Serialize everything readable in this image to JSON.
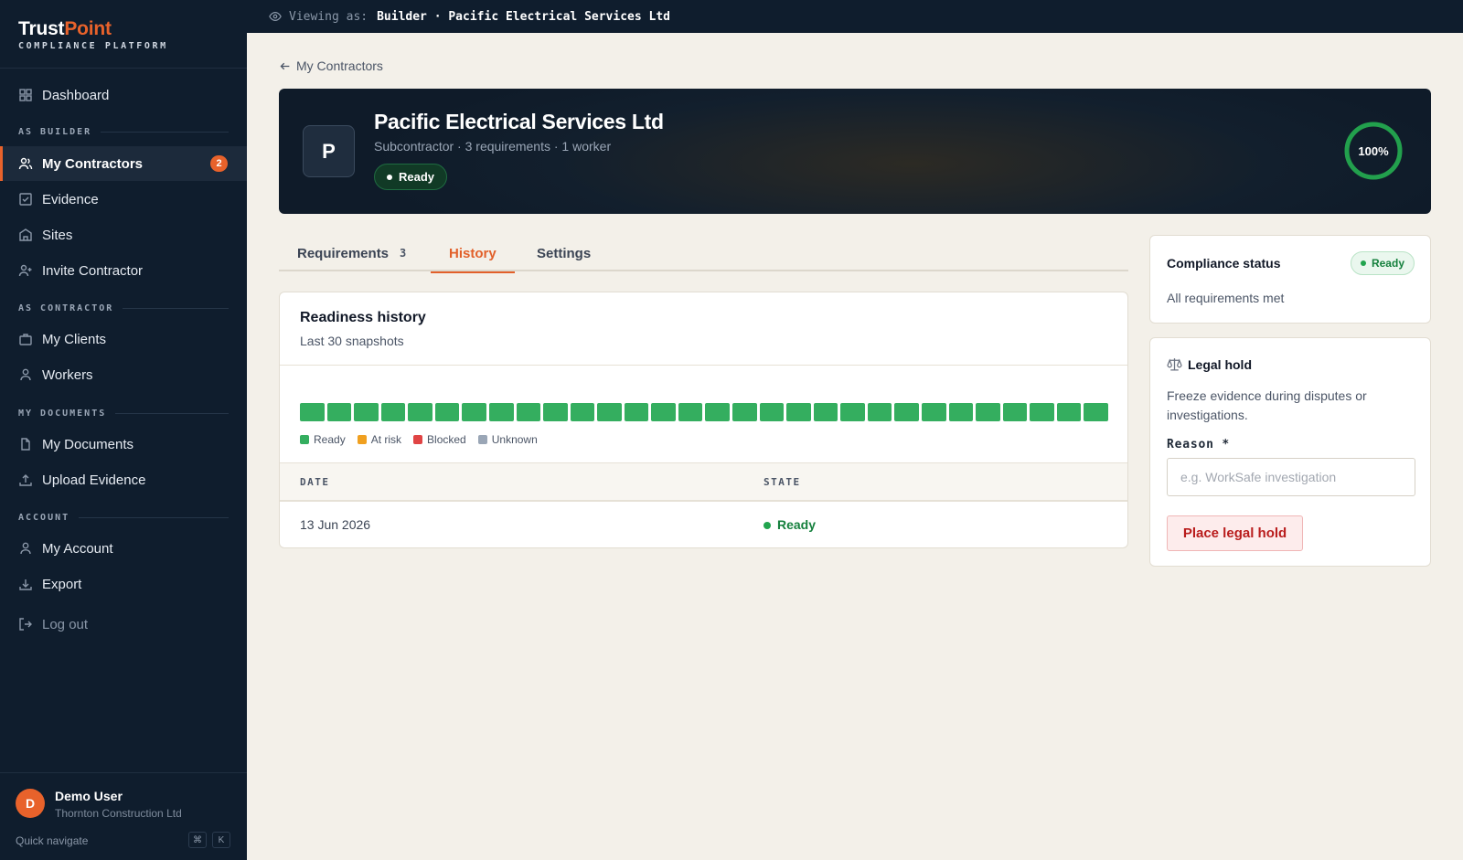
{
  "topbar": {
    "viewing_prefix": "Viewing as:",
    "viewing_value": "Builder · Pacific Electrical Services Ltd"
  },
  "brand": {
    "name_part1": "Trust",
    "name_part2": "Point",
    "subtitle": "COMPLIANCE PLATFORM",
    "accent_color": "#e8622b"
  },
  "sidebar": {
    "dashboard": "Dashboard",
    "sections": {
      "builder": "AS BUILDER",
      "contractor": "AS CONTRACTOR",
      "documents": "MY DOCUMENTS",
      "account": "ACCOUNT"
    },
    "items": [
      {
        "label": "My Contractors",
        "icon": "users-icon",
        "badge": "2",
        "active": true
      },
      {
        "label": "Evidence",
        "icon": "checkbox-icon"
      },
      {
        "label": "Sites",
        "icon": "building-icon"
      },
      {
        "label": "Invite Contractor",
        "icon": "user-plus-icon"
      },
      {
        "label": "My Clients",
        "icon": "briefcase-icon"
      },
      {
        "label": "Workers",
        "icon": "user-icon"
      },
      {
        "label": "My Documents",
        "icon": "document-icon"
      },
      {
        "label": "Upload Evidence",
        "icon": "upload-icon"
      },
      {
        "label": "My Account",
        "icon": "user-icon"
      },
      {
        "label": "Export",
        "icon": "download-icon"
      },
      {
        "label": "Log out",
        "icon": "logout-icon"
      }
    ],
    "user": {
      "initial": "D",
      "name": "Demo User",
      "org": "Thornton Construction Ltd"
    },
    "quick_navigate": "Quick navigate",
    "shortcut_keys": [
      "⌘",
      "K"
    ]
  },
  "main": {
    "back_link": "My Contractors",
    "hero": {
      "initial": "P",
      "title": "Pacific Electrical Services Ltd",
      "subtitle": "Subcontractor · 3 requirements · 1 worker",
      "status": "Ready",
      "score_label": "100%",
      "score": 100
    },
    "tabs": [
      {
        "label": "Requirements",
        "count": "3"
      },
      {
        "label": "History",
        "active": true
      },
      {
        "label": "Settings"
      }
    ],
    "history": {
      "title": "Readiness history",
      "subtitle": "Last 30 snapshots",
      "snapshots": [
        "ready",
        "ready",
        "ready",
        "ready",
        "ready",
        "ready",
        "ready",
        "ready",
        "ready",
        "ready",
        "ready",
        "ready",
        "ready",
        "ready",
        "ready",
        "ready",
        "ready",
        "ready",
        "ready",
        "ready",
        "ready",
        "ready",
        "ready",
        "ready",
        "ready",
        "ready",
        "ready",
        "ready",
        "ready",
        "ready"
      ],
      "legend": [
        {
          "label": "Ready",
          "color": "#34ae5f"
        },
        {
          "label": "At risk",
          "color": "#f0a020"
        },
        {
          "label": "Blocked",
          "color": "#e04444"
        },
        {
          "label": "Unknown",
          "color": "#9aa6b6"
        }
      ],
      "columns": [
        "DATE",
        "STATE"
      ],
      "rows": [
        {
          "date": "13 Jun 2026",
          "state": "Ready"
        }
      ]
    },
    "compliance": {
      "title": "Compliance status",
      "status": "Ready",
      "subtitle": "All requirements met"
    },
    "legal_hold": {
      "title": "Legal hold",
      "description": "Freeze evidence during disputes or investigations.",
      "reason_label": "Reason *",
      "reason_placeholder": "e.g. WorkSafe investigation",
      "reason_value": "",
      "button": "Place legal hold"
    }
  }
}
